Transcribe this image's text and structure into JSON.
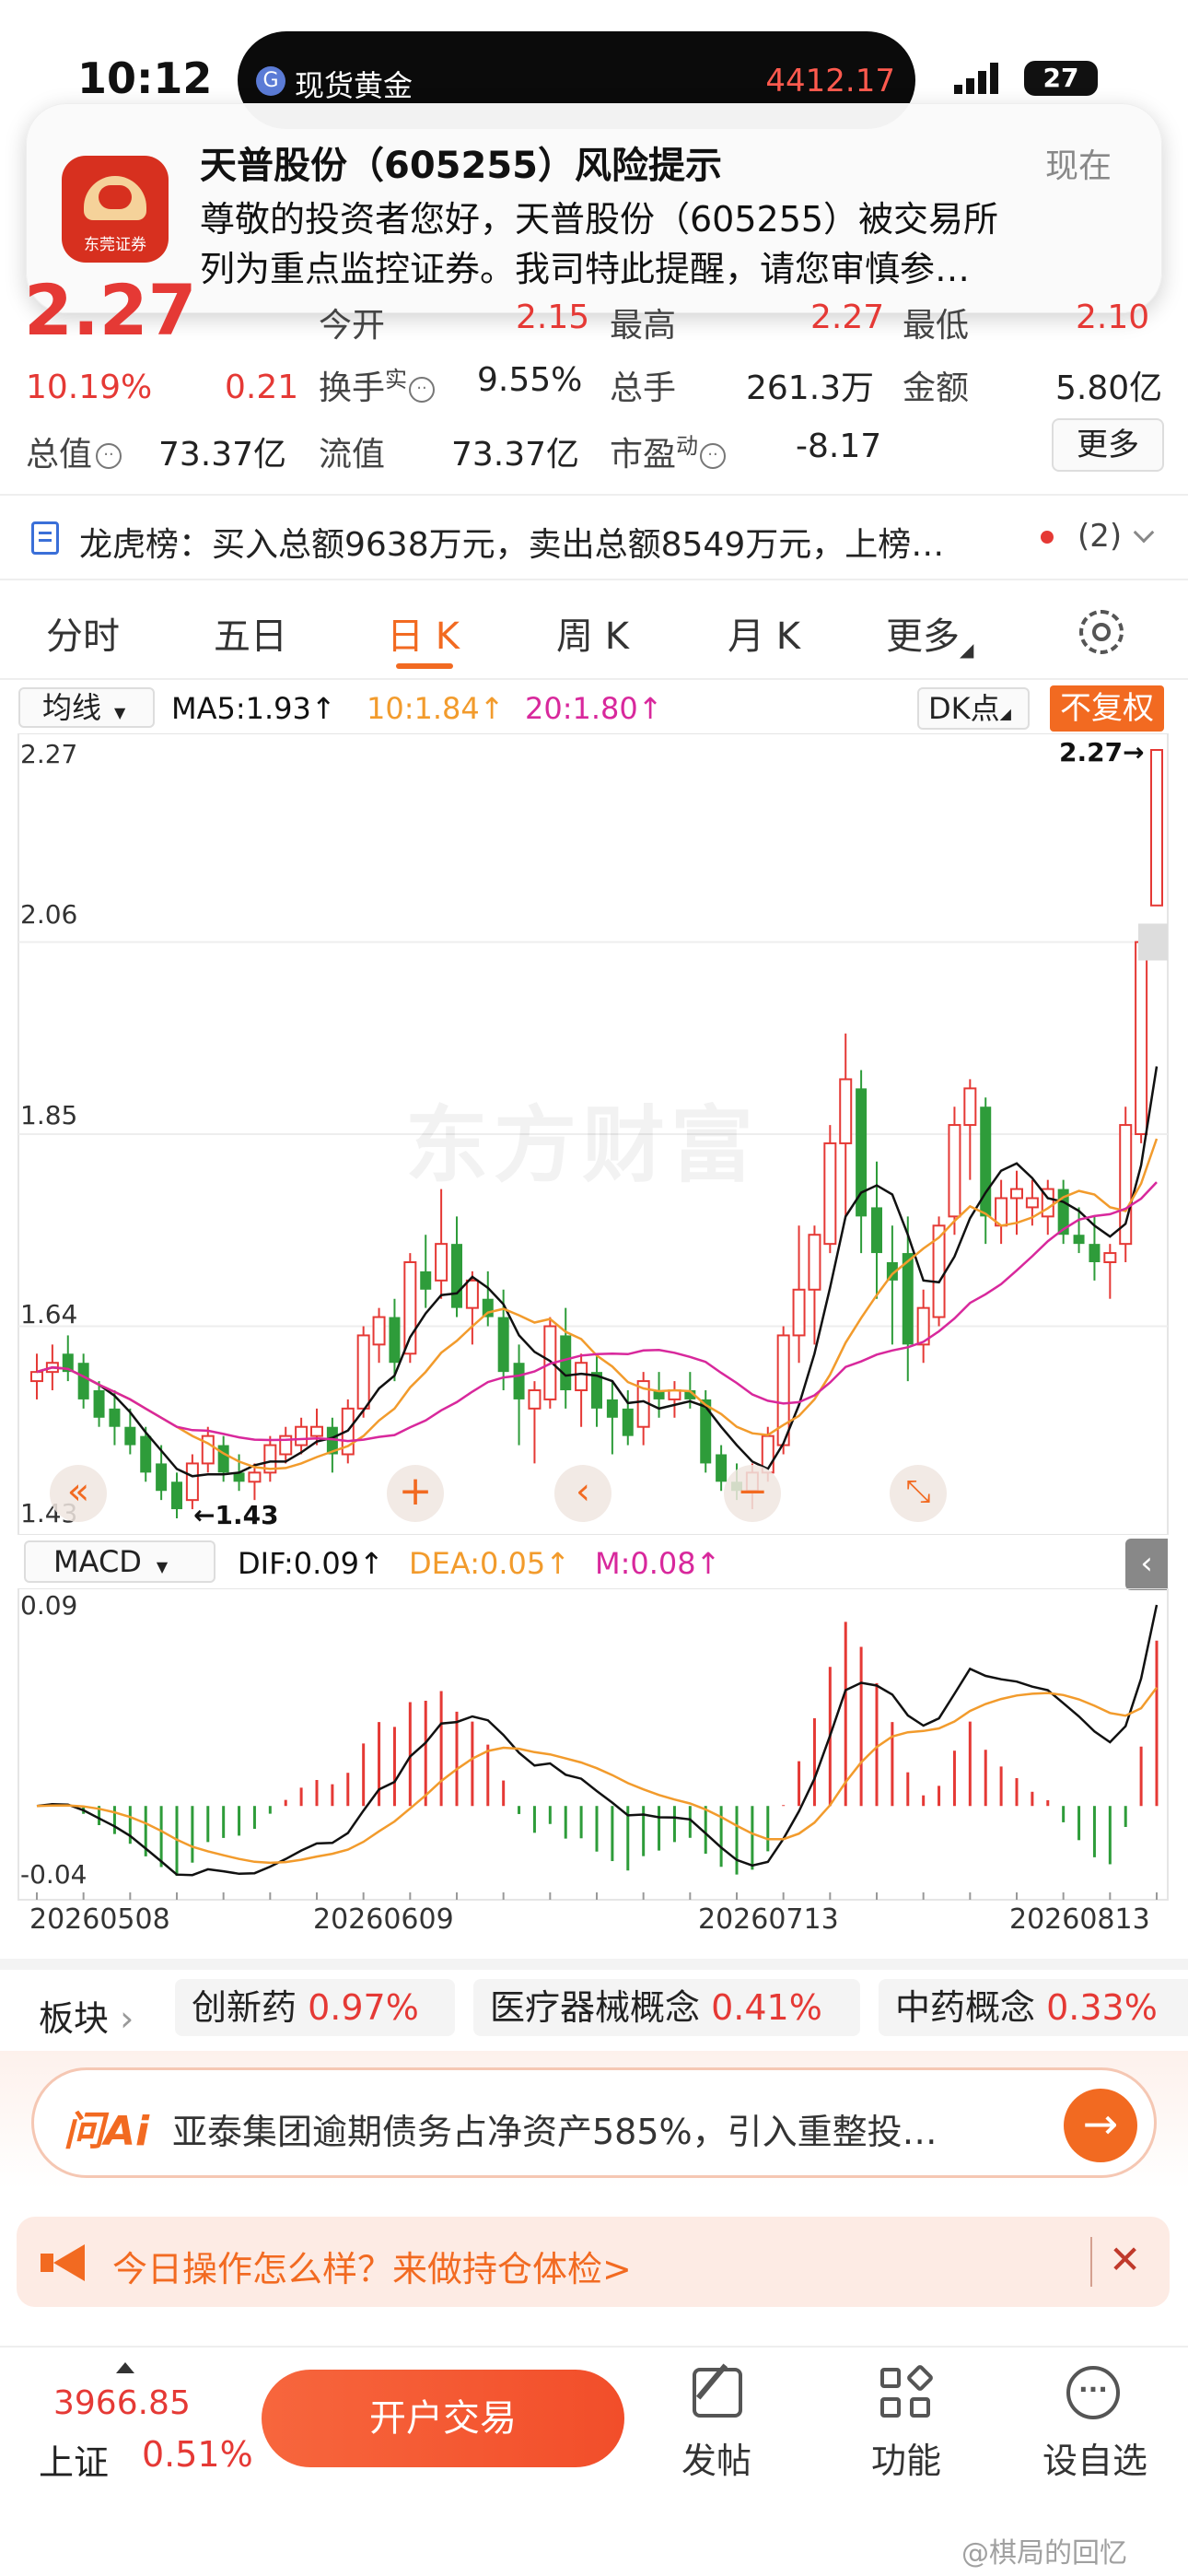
{
  "status_bar": {
    "time": "10:12",
    "island_label": "现货黄金",
    "island_value": "4412.17",
    "battery": "27"
  },
  "notification": {
    "title": "天普股份（605255）风险提示",
    "time": "现在",
    "line1": "尊敬的投资者您好，天普股份（605255）被交易所",
    "line2": "列为重点监控证券。我司特此提醒，请您审慎参…",
    "app_logo_text": "东莞证券"
  },
  "quote": {
    "price": "2.27",
    "pct": "10.19%",
    "chg": "0.21",
    "row1": [
      {
        "label": "今开",
        "value": "2.15"
      },
      {
        "label": "最高",
        "value": "2.27"
      },
      {
        "label": "最低",
        "value": "2.10"
      }
    ],
    "row2": [
      {
        "label": "换手",
        "sup": "实",
        "value": "9.55%"
      },
      {
        "label": "总手",
        "value": "261.3万"
      },
      {
        "label": "金额",
        "value": "5.80亿"
      }
    ],
    "row3": [
      {
        "label": "总值",
        "value": "73.37亿"
      },
      {
        "label": "流值",
        "value": "73.37亿"
      },
      {
        "label": "市盈",
        "sup": "动",
        "value": "-8.17"
      }
    ],
    "more_button": "更多"
  },
  "lhb": {
    "text": "龙虎榜：买入总额9638万元，卖出总额8549万元，上榜…",
    "count": "(2)"
  },
  "tabs": [
    {
      "label": "分时",
      "active": false
    },
    {
      "label": "五日",
      "active": false
    },
    {
      "label": "日 K",
      "active": true
    },
    {
      "label": "周 K",
      "active": false
    },
    {
      "label": "月 K",
      "active": false
    },
    {
      "label": "更多",
      "active": false
    }
  ],
  "ma_bar": {
    "selector": "均线",
    "ma5": "MA5:1.93",
    "ma10": "10:1.84",
    "ma20": "20:1.80",
    "dk": "DK点",
    "fq": "不复权"
  },
  "price_axis": [
    "2.27",
    "2.06",
    "1.85",
    "1.64",
    "1.43"
  ],
  "kline": {
    "high_marker": "2.27→",
    "low_marker": "←1.43",
    "watermark": "东方财富"
  },
  "macd_bar": {
    "selector": "MACD",
    "dif": "DIF:0.09",
    "dea": "DEA:0.05",
    "m": "M:0.08"
  },
  "macd_axis": [
    "0.09",
    "-0.04"
  ],
  "dates": [
    "20260508",
    "20260609",
    "20260713",
    "20260813"
  ],
  "colors": {
    "up": "#e53935",
    "down": "#2e9c3a",
    "accent": "#f26a21",
    "ma10": "#f29b2c",
    "ma20": "#d8289c"
  },
  "sectors": {
    "label": "板块",
    "items": [
      {
        "name": "创新药",
        "pct": "0.97%"
      },
      {
        "name": "医疗器械概念",
        "pct": "0.41%"
      },
      {
        "name": "中药概念",
        "pct": "0.33%"
      }
    ]
  },
  "ai": {
    "logo": "问Ai",
    "text": "亚泰集团逾期债务占净资产585%，引入重整投…"
  },
  "promo": {
    "text": "今日操作怎么样？来做持仓体检>"
  },
  "bottom": {
    "index_value": "3966.85",
    "index_name": "上证",
    "index_pct": "0.51%",
    "trade_button": "开户交易",
    "post": "发帖",
    "func": "功能",
    "watch": "设自选"
  },
  "watermark_user": "@棋局的回忆",
  "chart_data": {
    "type": "candlestick",
    "ylim": [
      1.43,
      2.27
    ],
    "ohlc": [
      [
        1.58,
        1.61,
        1.56,
        1.59
      ],
      [
        1.59,
        1.62,
        1.57,
        1.6
      ],
      [
        1.61,
        1.63,
        1.58,
        1.59
      ],
      [
        1.6,
        1.61,
        1.55,
        1.56
      ],
      [
        1.57,
        1.58,
        1.53,
        1.54
      ],
      [
        1.55,
        1.57,
        1.51,
        1.53
      ],
      [
        1.53,
        1.55,
        1.5,
        1.51
      ],
      [
        1.52,
        1.53,
        1.47,
        1.48
      ],
      [
        1.49,
        1.51,
        1.45,
        1.46
      ],
      [
        1.47,
        1.48,
        1.43,
        1.44
      ],
      [
        1.45,
        1.5,
        1.44,
        1.49
      ],
      [
        1.49,
        1.53,
        1.48,
        1.52
      ],
      [
        1.51,
        1.52,
        1.47,
        1.48
      ],
      [
        1.48,
        1.5,
        1.46,
        1.47
      ],
      [
        1.47,
        1.49,
        1.45,
        1.48
      ],
      [
        1.48,
        1.52,
        1.47,
        1.51
      ],
      [
        1.5,
        1.53,
        1.49,
        1.52
      ],
      [
        1.51,
        1.54,
        1.5,
        1.53
      ],
      [
        1.52,
        1.55,
        1.51,
        1.53
      ],
      [
        1.53,
        1.54,
        1.48,
        1.5
      ],
      [
        1.5,
        1.56,
        1.49,
        1.55
      ],
      [
        1.55,
        1.64,
        1.54,
        1.63
      ],
      [
        1.62,
        1.66,
        1.6,
        1.65
      ],
      [
        1.65,
        1.67,
        1.58,
        1.6
      ],
      [
        1.61,
        1.72,
        1.6,
        1.71
      ],
      [
        1.7,
        1.74,
        1.66,
        1.68
      ],
      [
        1.69,
        1.79,
        1.67,
        1.73
      ],
      [
        1.73,
        1.76,
        1.65,
        1.66
      ],
      [
        1.66,
        1.7,
        1.62,
        1.69
      ],
      [
        1.67,
        1.7,
        1.64,
        1.65
      ],
      [
        1.65,
        1.68,
        1.57,
        1.59
      ],
      [
        1.6,
        1.62,
        1.51,
        1.56
      ],
      [
        1.55,
        1.58,
        1.49,
        1.57
      ],
      [
        1.56,
        1.65,
        1.55,
        1.64
      ],
      [
        1.63,
        1.66,
        1.55,
        1.57
      ],
      [
        1.57,
        1.61,
        1.53,
        1.6
      ],
      [
        1.59,
        1.61,
        1.53,
        1.55
      ],
      [
        1.56,
        1.58,
        1.5,
        1.54
      ],
      [
        1.55,
        1.57,
        1.51,
        1.52
      ],
      [
        1.53,
        1.59,
        1.51,
        1.58
      ],
      [
        1.57,
        1.59,
        1.54,
        1.56
      ],
      [
        1.56,
        1.58,
        1.54,
        1.57
      ],
      [
        1.57,
        1.59,
        1.55,
        1.56
      ],
      [
        1.56,
        1.57,
        1.48,
        1.49
      ],
      [
        1.5,
        1.51,
        1.46,
        1.47
      ],
      [
        1.47,
        1.49,
        1.45,
        1.46
      ],
      [
        1.46,
        1.49,
        1.44,
        1.48
      ],
      [
        1.48,
        1.53,
        1.47,
        1.52
      ],
      [
        1.51,
        1.64,
        1.5,
        1.63
      ],
      [
        1.63,
        1.75,
        1.6,
        1.68
      ],
      [
        1.68,
        1.75,
        1.62,
        1.74
      ],
      [
        1.73,
        1.86,
        1.72,
        1.84
      ],
      [
        1.84,
        1.96,
        1.76,
        1.91
      ],
      [
        1.9,
        1.92,
        1.72,
        1.76
      ],
      [
        1.77,
        1.82,
        1.67,
        1.72
      ],
      [
        1.71,
        1.75,
        1.62,
        1.69
      ],
      [
        1.72,
        1.76,
        1.58,
        1.62
      ],
      [
        1.62,
        1.68,
        1.6,
        1.66
      ],
      [
        1.65,
        1.76,
        1.64,
        1.75
      ],
      [
        1.76,
        1.88,
        1.74,
        1.86
      ],
      [
        1.86,
        1.91,
        1.8,
        1.9
      ],
      [
        1.88,
        1.89,
        1.73,
        1.76
      ],
      [
        1.75,
        1.8,
        1.73,
        1.78
      ],
      [
        1.78,
        1.81,
        1.74,
        1.79
      ],
      [
        1.77,
        1.8,
        1.75,
        1.78
      ],
      [
        1.76,
        1.8,
        1.74,
        1.79
      ],
      [
        1.79,
        1.8,
        1.73,
        1.74
      ],
      [
        1.74,
        1.77,
        1.72,
        1.73
      ],
      [
        1.73,
        1.76,
        1.69,
        1.71
      ],
      [
        1.71,
        1.73,
        1.67,
        1.72
      ],
      [
        1.73,
        1.88,
        1.71,
        1.86
      ],
      [
        1.85,
        2.06,
        1.84,
        2.06
      ],
      [
        2.1,
        2.27,
        2.1,
        2.27
      ]
    ],
    "macd_range": [
      -0.04,
      0.09
    ]
  }
}
